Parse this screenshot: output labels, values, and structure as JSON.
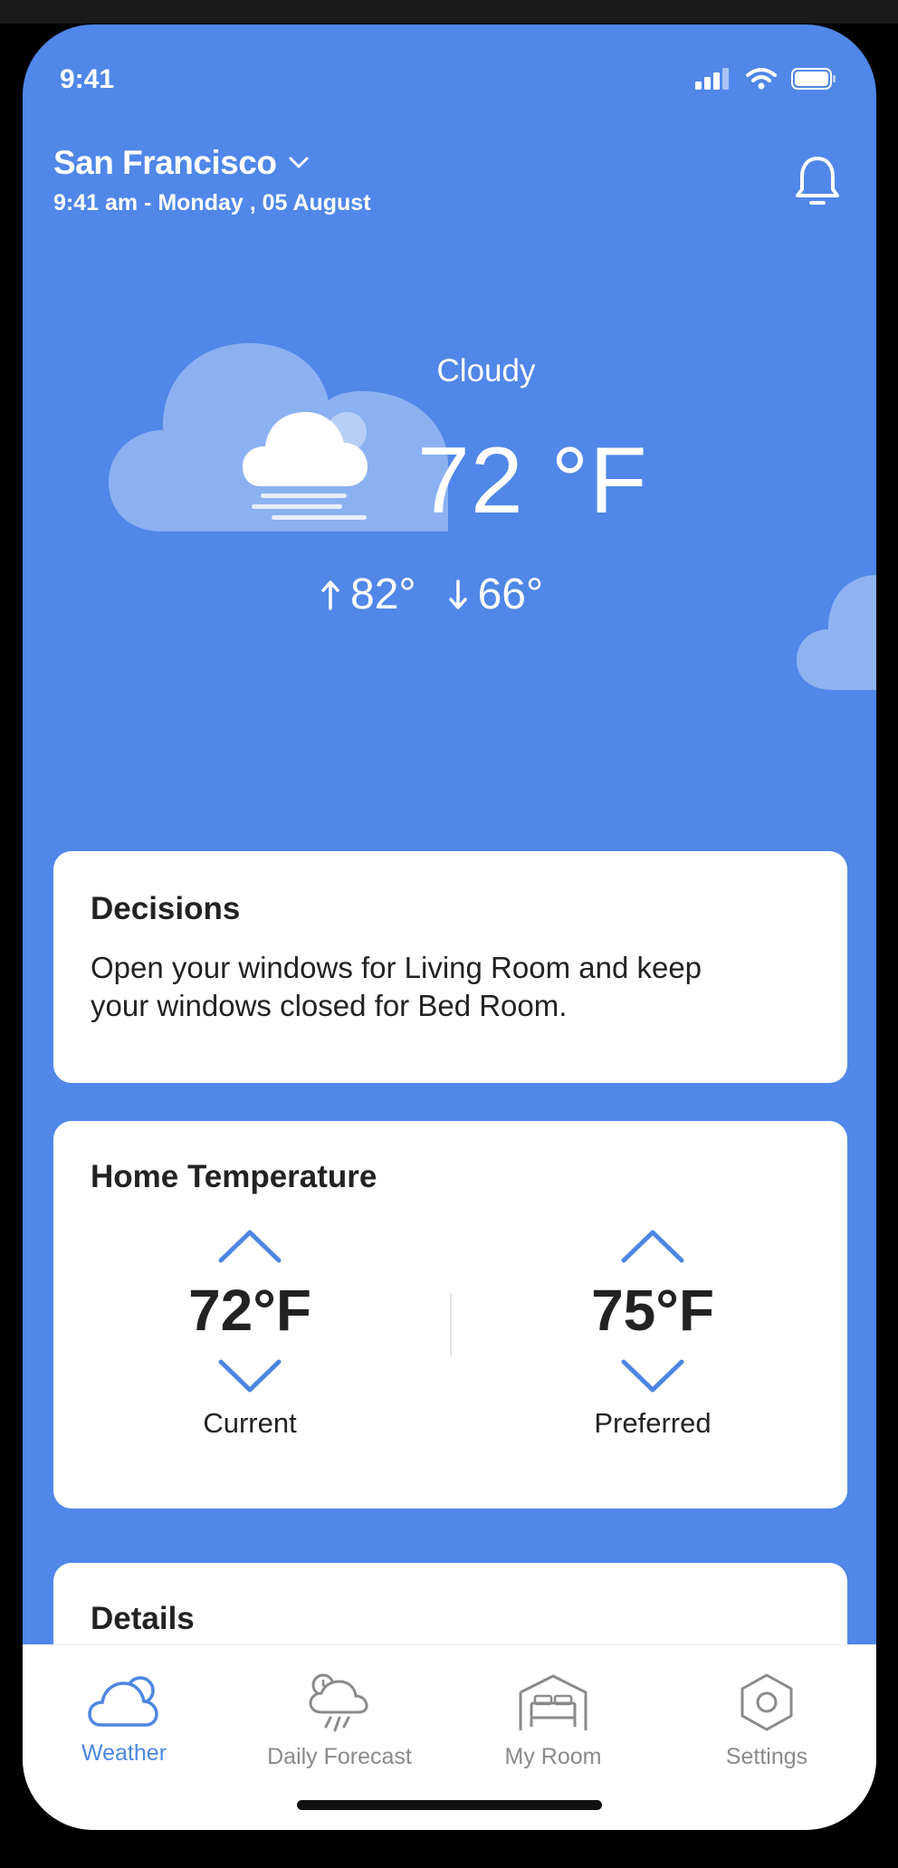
{
  "status_bar": {
    "time": "9:41"
  },
  "header": {
    "city": "San Francisco",
    "datetime": "9:41 am - Monday , 05 August"
  },
  "weather": {
    "condition": "Cloudy",
    "temperature": "72 °F",
    "high": "82°",
    "low": "66°"
  },
  "decisions": {
    "title": "Decisions",
    "text": "Open your windows for Living Room and keep your windows closed for Bed Room."
  },
  "home_temperature": {
    "title": "Home Temperature",
    "current": {
      "value": "72°F",
      "label": "Current"
    },
    "preferred": {
      "value": "75°F",
      "label": "Preferred"
    }
  },
  "details": {
    "title": "Details"
  },
  "tabs": [
    {
      "label": "Weather",
      "icon": "cloud-sun-icon",
      "active": true
    },
    {
      "label": "Daily Forecast",
      "icon": "rain-clock-icon",
      "active": false
    },
    {
      "label": "My Room",
      "icon": "bed-house-icon",
      "active": false
    },
    {
      "label": "Settings",
      "icon": "hexagon-settings-icon",
      "active": false
    }
  ],
  "colors": {
    "background": "#5087E8",
    "accent": "#4C86E2",
    "card": "#FFFFFF"
  }
}
